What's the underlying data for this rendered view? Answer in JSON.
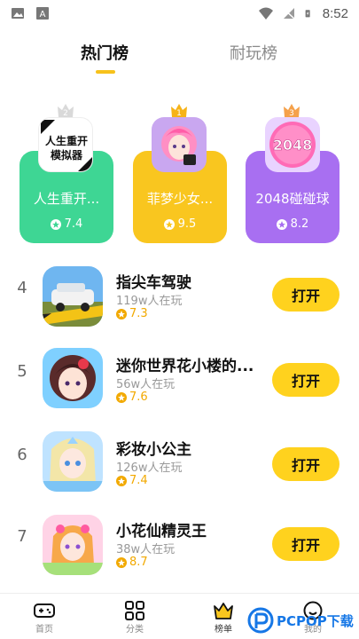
{
  "status_bar": {
    "time": "8:52"
  },
  "tabs": [
    {
      "label": "热门榜",
      "active": true
    },
    {
      "label": "耐玩榜",
      "active": false
    }
  ],
  "podium": [
    {
      "rank": "2",
      "name": "人生重开...",
      "rating": "7.4",
      "icon_text_1": "人生重开",
      "icon_text_2": "模拟器",
      "color": "#3ed694"
    },
    {
      "rank": "1",
      "name": "菲梦少女...",
      "rating": "9.5",
      "color": "#f9c61f"
    },
    {
      "rank": "3",
      "name": "2048碰碰球",
      "rating": "8.2",
      "icon_text_1": "2048",
      "color": "#a86ff1"
    }
  ],
  "list": [
    {
      "rank": "4",
      "title": "指尖车驾驶",
      "players": "119w人在玩",
      "rating": "7.3",
      "button": "打开"
    },
    {
      "rank": "5",
      "title": "迷你世界花小楼的...",
      "players": "56w人在玩",
      "rating": "7.6",
      "button": "打开"
    },
    {
      "rank": "6",
      "title": "彩妆小公主",
      "players": "126w人在玩",
      "rating": "7.4",
      "button": "打开"
    },
    {
      "rank": "7",
      "title": "小花仙精灵王",
      "players": "38w人在玩",
      "rating": "8.7",
      "button": "打开"
    }
  ],
  "bottom_nav": [
    {
      "label": "首页",
      "icon": "gamepad-icon"
    },
    {
      "label": "分类",
      "icon": "grid-icon"
    },
    {
      "label": "榜单",
      "icon": "crown-icon",
      "active": true
    },
    {
      "label": "我的",
      "icon": "smile-icon"
    }
  ],
  "watermark": {
    "text": "PCPOP下载"
  }
}
